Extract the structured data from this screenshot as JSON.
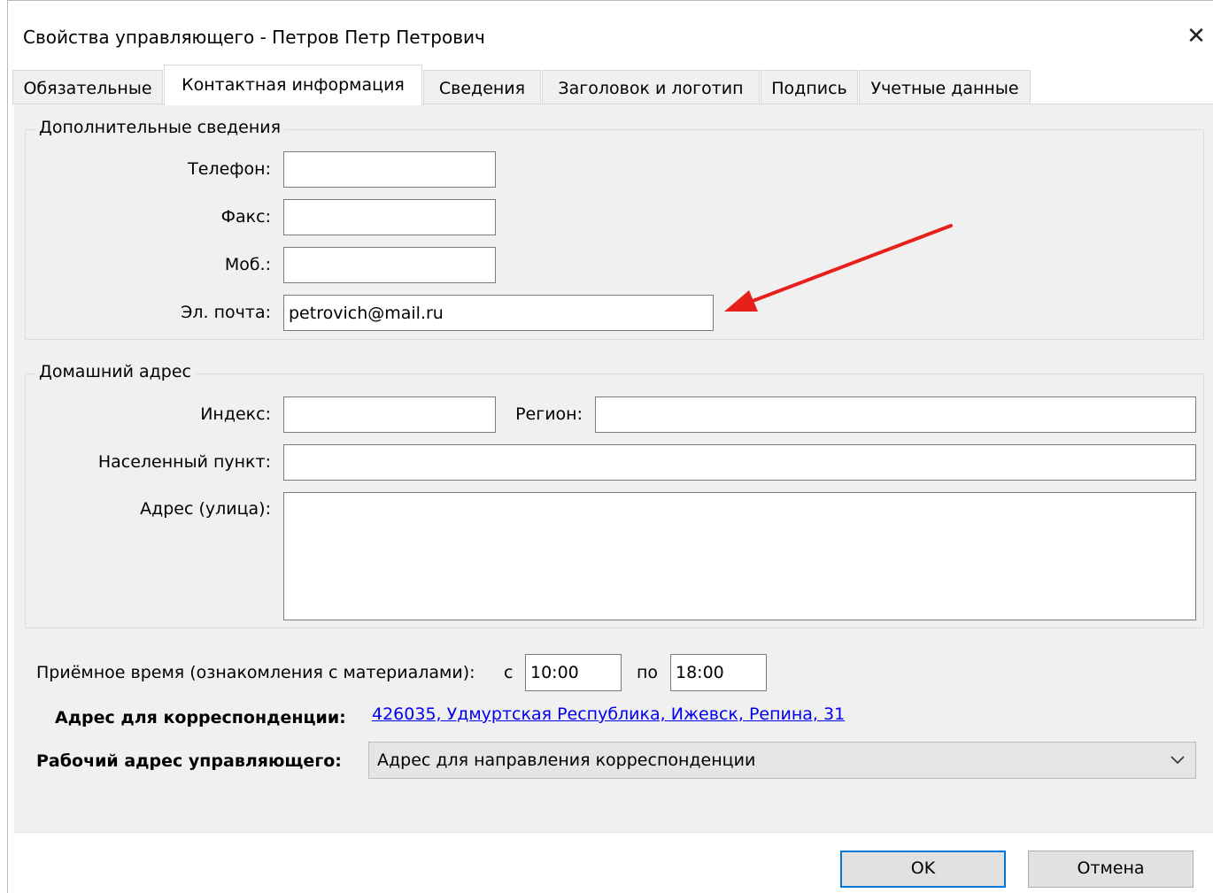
{
  "window": {
    "title": "Свойства управляющего - Петров Петр Петрович",
    "close_glyph": "✕"
  },
  "tabs": [
    {
      "label": "Обязательные",
      "active": false
    },
    {
      "label": "Контактная информация",
      "active": true
    },
    {
      "label": "Сведения",
      "active": false
    },
    {
      "label": "Заголовок и логотип",
      "active": false
    },
    {
      "label": "Подпись",
      "active": false
    },
    {
      "label": "Учетные данные",
      "active": false
    }
  ],
  "contact_group": {
    "legend": "Дополнительные сведения",
    "phone": {
      "label": "Телефон:",
      "value": ""
    },
    "fax": {
      "label": "Факс:",
      "value": ""
    },
    "mobile": {
      "label": "Моб.:",
      "value": ""
    },
    "email": {
      "label": "Эл. почта:",
      "value": "petrovich@mail.ru"
    }
  },
  "home_group": {
    "legend": "Домашний адрес",
    "index": {
      "label": "Индекс:",
      "value": ""
    },
    "region": {
      "label": "Регион:",
      "value": ""
    },
    "locality": {
      "label": "Населенный пункт:",
      "value": ""
    },
    "street": {
      "label": "Адрес (улица):",
      "value": ""
    }
  },
  "reception": {
    "label": "Приёмное время (ознакомления с материалами):",
    "from_label": "с",
    "from_value": "10:00",
    "to_label": "по",
    "to_value": "18:00"
  },
  "correspondence": {
    "label": "Адрес для корреспонденции:",
    "link_text": "426035, Удмуртская Республика, Ижевск, Репина, 31"
  },
  "work_address": {
    "label": "Рабочий адрес управляющего:",
    "selected": "Адрес для направления корреспонденции"
  },
  "buttons": {
    "ok": "OK",
    "cancel": "Отмена"
  },
  "colors": {
    "annotation_arrow": "#e8201c",
    "link": "#0000ee",
    "default_button_border": "#0078d7"
  }
}
